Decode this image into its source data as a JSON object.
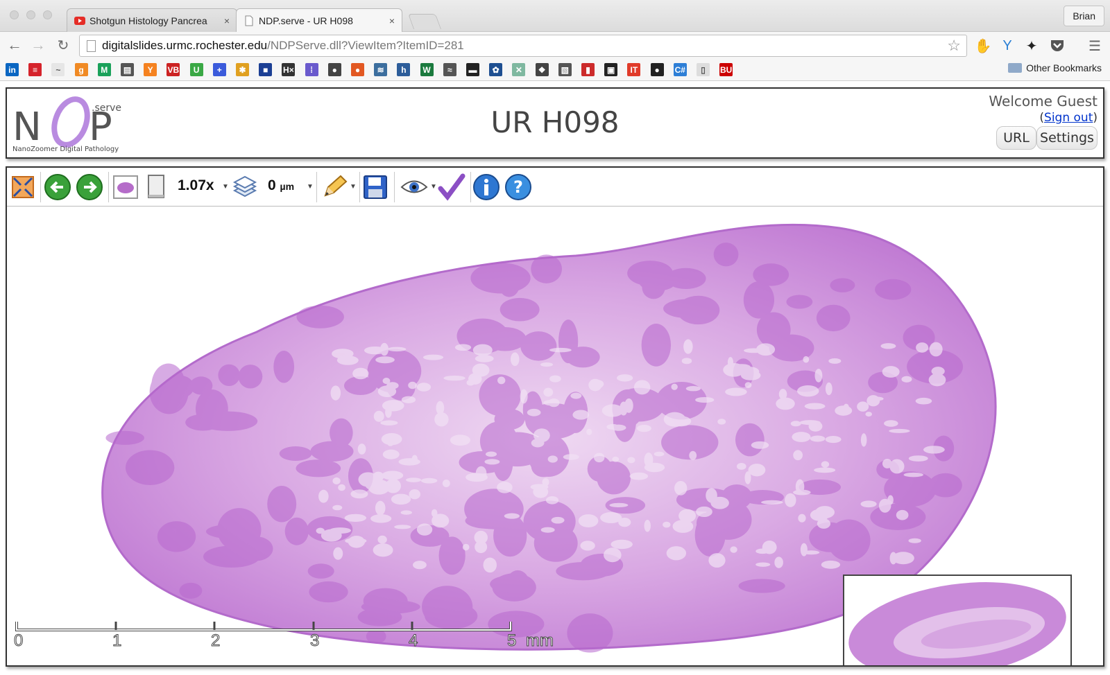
{
  "browser": {
    "tabs": [
      {
        "title": "Shotgun Histology Pancrea",
        "close": "×",
        "favicon": "youtube-icon"
      },
      {
        "title": "NDP.serve - UR H098",
        "close": "×",
        "favicon": "page-icon"
      }
    ],
    "profile_name": "Brian",
    "url_host": "digitalslides.urmc.rochester.edu",
    "url_path": "/NDPServe.dll?ViewItem?ItemID=281",
    "other_bookmarks": "Other Bookmarks",
    "bookmarks": [
      {
        "label": "in",
        "color": "#0a66c2"
      },
      {
        "label": "≡",
        "color": "#d5232b"
      },
      {
        "label": "~",
        "color": "#e6e6e6"
      },
      {
        "label": "g",
        "color": "#f08a24"
      },
      {
        "label": "M",
        "color": "#1aa15a"
      },
      {
        "label": "▤",
        "color": "#555555"
      },
      {
        "label": "Y",
        "color": "#f58220"
      },
      {
        "label": "VB",
        "color": "#cc2222"
      },
      {
        "label": "U",
        "color": "#3aa845"
      },
      {
        "label": "+",
        "color": "#3b5bdb"
      },
      {
        "label": "✱",
        "color": "#e0a020"
      },
      {
        "label": "■",
        "color": "#1c3f94"
      },
      {
        "label": "H×",
        "color": "#333333"
      },
      {
        "label": "⁞",
        "color": "#6a5acd"
      },
      {
        "label": "●",
        "color": "#444444"
      },
      {
        "label": "●",
        "color": "#e25822"
      },
      {
        "label": "≋",
        "color": "#3c6e9e"
      },
      {
        "label": "h",
        "color": "#2d5d9a"
      },
      {
        "label": "W",
        "color": "#1b7a3e"
      },
      {
        "label": "≈",
        "color": "#555555"
      },
      {
        "label": "▬",
        "color": "#222222"
      },
      {
        "label": "✿",
        "color": "#1e4f91"
      },
      {
        "label": "✕",
        "color": "#7fb8a0"
      },
      {
        "label": "❖",
        "color": "#444444"
      },
      {
        "label": "▧",
        "color": "#555555"
      },
      {
        "label": "▮",
        "color": "#cc2b2b"
      },
      {
        "label": "▣",
        "color": "#222222"
      },
      {
        "label": "IT",
        "color": "#e03b2a"
      },
      {
        "label": "●",
        "color": "#222222"
      },
      {
        "label": "C#",
        "color": "#2e7fd6"
      },
      {
        "label": "▯",
        "color": "#dddddd"
      },
      {
        "label": "BU",
        "color": "#cc0000"
      }
    ]
  },
  "page": {
    "logo_text": "NDP",
    "logo_sup": ".serve",
    "logo_caption": "NanoZoomer Digital Pathology",
    "title": "UR H098",
    "welcome": "Welcome Guest",
    "signout_prefix": "(",
    "signout_link": "Sign out",
    "signout_suffix": ")",
    "url_button": "URL",
    "settings_button": "Settings"
  },
  "viewer": {
    "zoom": "1.07x",
    "depth_value": "0",
    "depth_unit": "µm",
    "scale_labels": [
      "0",
      "1",
      "2",
      "3",
      "4",
      "5"
    ],
    "scale_unit": "mm",
    "tissue_color": "#c27ed6",
    "tissue_dark": "#a95fc7"
  }
}
